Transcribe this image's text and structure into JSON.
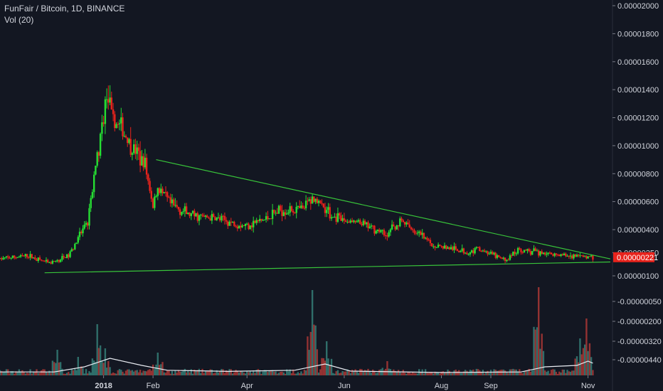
{
  "chart_data": {
    "type": "candlestick",
    "title": "FunFair / Bitcoin, 1D, BINANCE",
    "indicator_label": "Vol (20)",
    "x_ticks": [
      {
        "label": "2018",
        "date": "2018-01-01",
        "bold": true
      },
      {
        "label": "Feb",
        "date": "2018-02-01"
      },
      {
        "label": "Apr",
        "date": "2018-04-01"
      },
      {
        "label": "Jun",
        "date": "2018-06-01"
      },
      {
        "label": "Aug",
        "date": "2018-08-01"
      },
      {
        "label": "Sep",
        "date": "2018-09-01"
      },
      {
        "label": "Nov",
        "date": "2018-11-01"
      }
    ],
    "price_axis": {
      "ylim": [
        1e-06,
        2e-06
      ],
      "ticks": [
        "0.00002000",
        "0.00001800",
        "0.00001600",
        "0.00001400",
        "0.00001200",
        "0.00001000",
        "0.00000800",
        "0.00000600",
        "0.00000400",
        "0.00000250",
        "0.00000100"
      ]
    },
    "volume_axis": {
      "ticks": [
        "-0.00000050",
        "-0.00000200",
        "-0.00000320",
        "-0.00000440"
      ]
    },
    "last_price": "0.00000221",
    "price_path": [
      [
        "2017-10-28",
        2.1e-06
      ],
      [
        "2017-11-15",
        2.3e-06
      ],
      [
        "2017-11-28",
        1.8e-06
      ],
      [
        "2017-12-10",
        2.3e-06
      ],
      [
        "2017-12-22",
        4.5e-06
      ],
      [
        "2017-12-28",
        9e-06
      ],
      [
        "2018-01-03",
        1.35e-05
      ],
      [
        "2018-01-07",
        1.18e-05
      ],
      [
        "2018-01-12",
        1.12e-05
      ],
      [
        "2018-01-20",
        9.8e-06
      ],
      [
        "2018-01-27",
        8.6e-06
      ],
      [
        "2018-02-01",
        5.8e-06
      ],
      [
        "2018-02-04",
        7e-06
      ],
      [
        "2018-02-12",
        5.8e-06
      ],
      [
        "2018-02-25",
        5e-06
      ],
      [
        "2018-03-12",
        4.8e-06
      ],
      [
        "2018-03-30",
        4.3e-06
      ],
      [
        "2018-04-12",
        4.7e-06
      ],
      [
        "2018-04-22",
        5.4e-06
      ],
      [
        "2018-05-06",
        5.4e-06
      ],
      [
        "2018-05-12",
        6.3e-06
      ],
      [
        "2018-05-20",
        5.5e-06
      ],
      [
        "2018-05-26",
        4.8e-06
      ],
      [
        "2018-06-12",
        4.4e-06
      ],
      [
        "2018-06-27",
        3.7e-06
      ],
      [
        "2018-07-07",
        4.6e-06
      ],
      [
        "2018-07-14",
        4e-06
      ],
      [
        "2018-07-27",
        3e-06
      ],
      [
        "2018-08-18",
        2.5e-06
      ],
      [
        "2018-08-24",
        2.8e-06
      ],
      [
        "2018-09-10",
        2e-06
      ],
      [
        "2018-09-18",
        2.7e-06
      ],
      [
        "2018-10-01",
        2.5e-06
      ],
      [
        "2018-10-20",
        2.3e-06
      ],
      [
        "2018-11-04",
        2.2e-06
      ]
    ],
    "volume_spikes": [
      [
        "2017-12-03",
        0.9
      ],
      [
        "2017-12-16",
        0.65
      ],
      [
        "2017-12-28",
        1.8
      ],
      [
        "2018-01-02",
        0.95
      ],
      [
        "2018-02-04",
        0.8
      ],
      [
        "2018-05-12",
        3.0
      ],
      [
        "2018-05-21",
        1.2
      ],
      [
        "2018-06-28",
        0.5
      ],
      [
        "2018-10-01",
        3.1
      ],
      [
        "2018-10-27",
        1.3
      ],
      [
        "2018-10-31",
        2.0
      ]
    ],
    "volume_ma": [
      [
        "2017-10-28",
        0.12
      ],
      [
        "2017-12-01",
        0.12
      ],
      [
        "2017-12-20",
        0.3
      ],
      [
        "2018-01-05",
        0.6
      ],
      [
        "2018-01-25",
        0.35
      ],
      [
        "2018-02-10",
        0.18
      ],
      [
        "2018-03-20",
        0.14
      ],
      [
        "2018-05-01",
        0.18
      ],
      [
        "2018-05-20",
        0.4
      ],
      [
        "2018-06-05",
        0.15
      ],
      [
        "2018-08-01",
        0.1
      ],
      [
        "2018-09-20",
        0.12
      ],
      [
        "2018-10-05",
        0.3
      ],
      [
        "2018-10-25",
        0.35
      ],
      [
        "2018-11-01",
        0.5
      ],
      [
        "2018-11-04",
        0.43
      ]
    ],
    "trendlines": [
      {
        "name": "upper",
        "from": [
          "2018-02-03",
          9e-06
        ],
        "to": [
          "2018-11-15",
          2.1e-06
        ]
      },
      {
        "name": "lower",
        "from": [
          "2017-11-25",
          1.2e-06
        ],
        "to": [
          "2018-11-15",
          1.9e-06
        ]
      }
    ],
    "colors": {
      "background": "#131722",
      "up": "#26de33",
      "down": "#e8231c",
      "volume_up": "#2f6e6a",
      "volume_down": "#933232",
      "trendline": "#38c43a",
      "text": "#d1d4dc",
      "last_price_bg": "#e8231c"
    }
  }
}
